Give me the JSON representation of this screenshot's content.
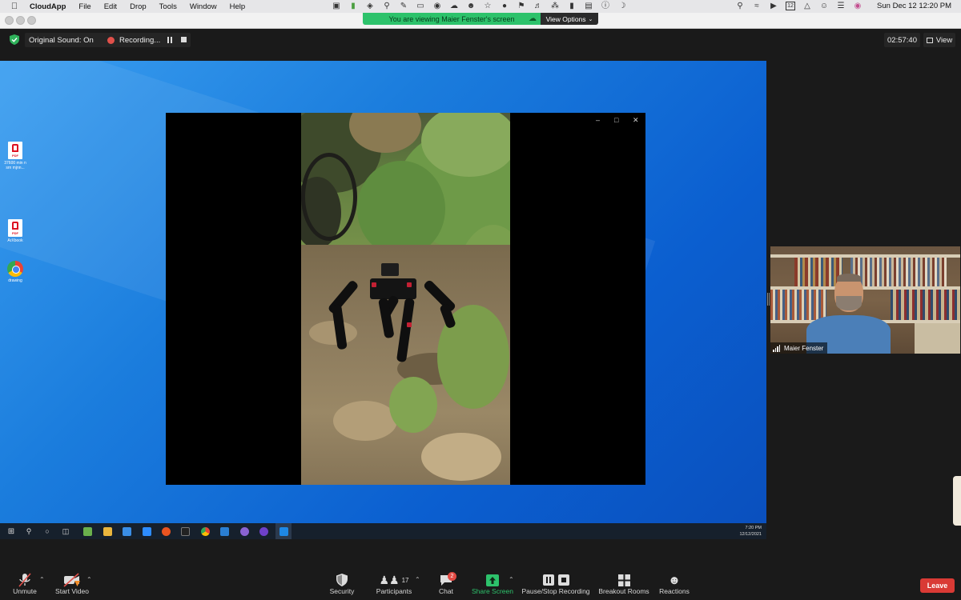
{
  "menubar": {
    "app_name": "CloudApp",
    "items": [
      "File",
      "Edit",
      "Drop",
      "Tools",
      "Window",
      "Help"
    ],
    "clock": "Sun Dec 12  12:20 PM",
    "calendar_day": "12"
  },
  "banner": {
    "viewing_text": "You are viewing Maier Fenster's screen",
    "view_options": "View Options"
  },
  "zoom_top": {
    "original_sound": "Original Sound: On",
    "recording": "Recording...",
    "timer": "02:57:40",
    "view_label": "View"
  },
  "desktop": {
    "icons": [
      {
        "label": "37600 min nsrn mjnn...",
        "type": "pdf"
      },
      {
        "label": "ArXbook",
        "type": "pdf"
      },
      {
        "label": "drawing",
        "type": "chrome"
      }
    ]
  },
  "taskbar": {
    "time": "7:20 PM",
    "date": "12/12/2021"
  },
  "participant": {
    "name": "Maier Fenster"
  },
  "toolbar": {
    "unmute": "Unmute",
    "start_video": "Start Video",
    "security": "Security",
    "participants": "Participants",
    "participants_count": "17",
    "chat": "Chat",
    "chat_badge": "2",
    "share_screen": "Share Screen",
    "pause_stop_recording": "Pause/Stop Recording",
    "breakout_rooms": "Breakout Rooms",
    "reactions": "Reactions",
    "leave": "Leave"
  },
  "colors": {
    "share_green": "#2dc26b",
    "leave_red": "#d93a35",
    "desktop_blue": "#0b5fd0"
  }
}
